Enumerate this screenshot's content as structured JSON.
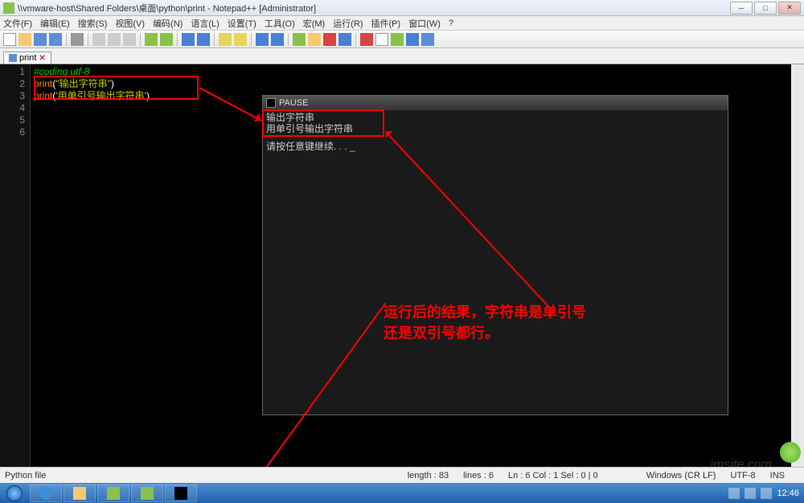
{
  "titlebar": {
    "path": "\\\\vmware-host\\Shared Folders\\桌面\\python\\print - Notepad++ [Administrator]"
  },
  "menu": {
    "items": [
      "文件(F)",
      "编辑(E)",
      "搜索(S)",
      "视图(V)",
      "编码(N)",
      "语言(L)",
      "设置(T)",
      "工具(O)",
      "宏(M)",
      "运行(R)",
      "插件(P)",
      "窗口(W)",
      "?"
    ]
  },
  "tab": {
    "name": "print",
    "close": "✕"
  },
  "gutter": [
    "1",
    "2",
    "3",
    "4",
    "5",
    "6"
  ],
  "code": {
    "l1_comment": "#coding utf-8",
    "l2_kw": "print",
    "l2_str": "\"输出字符串\"",
    "l3_kw": "print",
    "l3_str": "'用单引号输出字符串'"
  },
  "console": {
    "title": "PAUSE",
    "out1": "输出字符串",
    "out2": "用单引号输出字符串",
    "prompt": "请按任意键继续. . . _"
  },
  "annotation": {
    "line1": "运行后的结果，字符串是单引号",
    "line2": "还是双引号都行。"
  },
  "status": {
    "filetype": "Python file",
    "length": "length : 83",
    "lines": "lines : 6",
    "pos": "Ln : 6    Col : 1    Sel : 0 | 0",
    "eol": "Windows (CR LF)",
    "enc": "UTF-8",
    "ins": "INS"
  },
  "tray": {
    "time": "12:46"
  },
  "watermark": "jmsite.com"
}
